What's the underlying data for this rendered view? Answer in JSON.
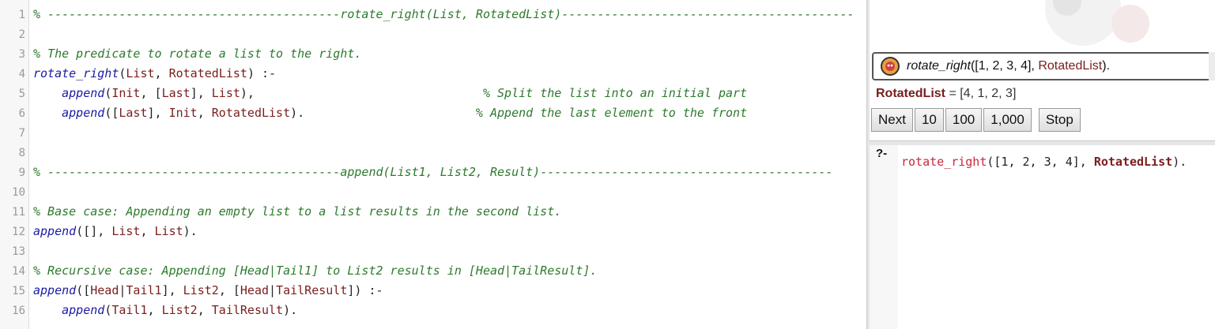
{
  "editor": {
    "lines": [
      {
        "num": "1",
        "parts": [
          {
            "t": "% -----------------------------------------",
            "c": "cm"
          },
          {
            "t": "rotate_right(List, RotatedList)",
            "c": "cm"
          },
          {
            "t": "-----------------------------------------",
            "c": "cm"
          }
        ]
      },
      {
        "num": "2",
        "parts": []
      },
      {
        "num": "3",
        "parts": [
          {
            "t": "% The predicate to rotate a list to the right.",
            "c": "cm"
          }
        ]
      },
      {
        "num": "4",
        "parts": [
          {
            "t": "rotate_right",
            "c": "fn"
          },
          {
            "t": "(",
            "c": "punc"
          },
          {
            "t": "List",
            "c": "var"
          },
          {
            "t": ", ",
            "c": "punc"
          },
          {
            "t": "RotatedList",
            "c": "var"
          },
          {
            "t": ") :-",
            "c": "punc"
          }
        ]
      },
      {
        "num": "5",
        "parts": [
          {
            "t": "    ",
            "c": "punc"
          },
          {
            "t": "append",
            "c": "fn"
          },
          {
            "t": "(",
            "c": "punc"
          },
          {
            "t": "Init",
            "c": "var"
          },
          {
            "t": ", [",
            "c": "punc"
          },
          {
            "t": "Last",
            "c": "var"
          },
          {
            "t": "], ",
            "c": "punc"
          },
          {
            "t": "List",
            "c": "var"
          },
          {
            "t": "),",
            "c": "punc"
          },
          {
            "t": "                                % Split the list into an initial part",
            "c": "cm"
          }
        ]
      },
      {
        "num": "6",
        "parts": [
          {
            "t": "    ",
            "c": "punc"
          },
          {
            "t": "append",
            "c": "fn"
          },
          {
            "t": "([",
            "c": "punc"
          },
          {
            "t": "Last",
            "c": "var"
          },
          {
            "t": "], ",
            "c": "punc"
          },
          {
            "t": "Init",
            "c": "var"
          },
          {
            "t": ", ",
            "c": "punc"
          },
          {
            "t": "RotatedList",
            "c": "var"
          },
          {
            "t": ").",
            "c": "punc"
          },
          {
            "t": "                        % Append the last element to the front",
            "c": "cm"
          }
        ]
      },
      {
        "num": "7",
        "parts": []
      },
      {
        "num": "8",
        "parts": []
      },
      {
        "num": "9",
        "parts": [
          {
            "t": "% -----------------------------------------",
            "c": "cm"
          },
          {
            "t": "append(List1, List2, Result)",
            "c": "cm"
          },
          {
            "t": "-----------------------------------------",
            "c": "cm"
          }
        ]
      },
      {
        "num": "10",
        "parts": []
      },
      {
        "num": "11",
        "parts": [
          {
            "t": "% Base case: Appending an empty list to a list results in the second list.",
            "c": "cm"
          }
        ]
      },
      {
        "num": "12",
        "parts": [
          {
            "t": "append",
            "c": "fn"
          },
          {
            "t": "([], ",
            "c": "punc"
          },
          {
            "t": "List",
            "c": "var"
          },
          {
            "t": ", ",
            "c": "punc"
          },
          {
            "t": "List",
            "c": "var"
          },
          {
            "t": ").",
            "c": "punc"
          }
        ]
      },
      {
        "num": "13",
        "parts": []
      },
      {
        "num": "14",
        "parts": [
          {
            "t": "% Recursive case: Appending [Head|Tail1] to List2 results in [Head|TailResult].",
            "c": "cm"
          }
        ]
      },
      {
        "num": "15",
        "parts": [
          {
            "t": "append",
            "c": "fn"
          },
          {
            "t": "([",
            "c": "punc"
          },
          {
            "t": "Head",
            "c": "var"
          },
          {
            "t": "|",
            "c": "punc"
          },
          {
            "t": "Tail1",
            "c": "var"
          },
          {
            "t": "], ",
            "c": "punc"
          },
          {
            "t": "List2",
            "c": "var"
          },
          {
            "t": ", [",
            "c": "punc"
          },
          {
            "t": "Head",
            "c": "var"
          },
          {
            "t": "|",
            "c": "punc"
          },
          {
            "t": "TailResult",
            "c": "var"
          },
          {
            "t": "]) :-",
            "c": "punc"
          }
        ]
      },
      {
        "num": "16",
        "parts": [
          {
            "t": "    ",
            "c": "punc"
          },
          {
            "t": "append",
            "c": "fn"
          },
          {
            "t": "(",
            "c": "punc"
          },
          {
            "t": "Tail1",
            "c": "var"
          },
          {
            "t": ", ",
            "c": "punc"
          },
          {
            "t": "List2",
            "c": "var"
          },
          {
            "t": ", ",
            "c": "punc"
          },
          {
            "t": "TailResult",
            "c": "var"
          },
          {
            "t": ").",
            "c": "punc"
          }
        ]
      }
    ]
  },
  "query_panel": {
    "query_fn": "rotate_right",
    "query_args": "([1, 2, 3, 4], ",
    "query_var": "RotatedList",
    "query_end": ").",
    "answer_name": "RotatedList",
    "answer_eq": " = [4, 1, 2, 3]",
    "buttons": {
      "next": "Next",
      "ten": "10",
      "hundred": "100",
      "thousand": "1,000",
      "stop": "Stop"
    }
  },
  "console": {
    "prompt": "?-",
    "input_fn": "rotate_right",
    "input_args": "([1, 2, 3, 4], ",
    "input_var": "RotatedList",
    "input_end": ")."
  },
  "colors": {
    "comment": "#2c7a2c",
    "variable": "#7a1d1d",
    "function": "#1a1aa6",
    "query_fn": "#c7293b"
  }
}
